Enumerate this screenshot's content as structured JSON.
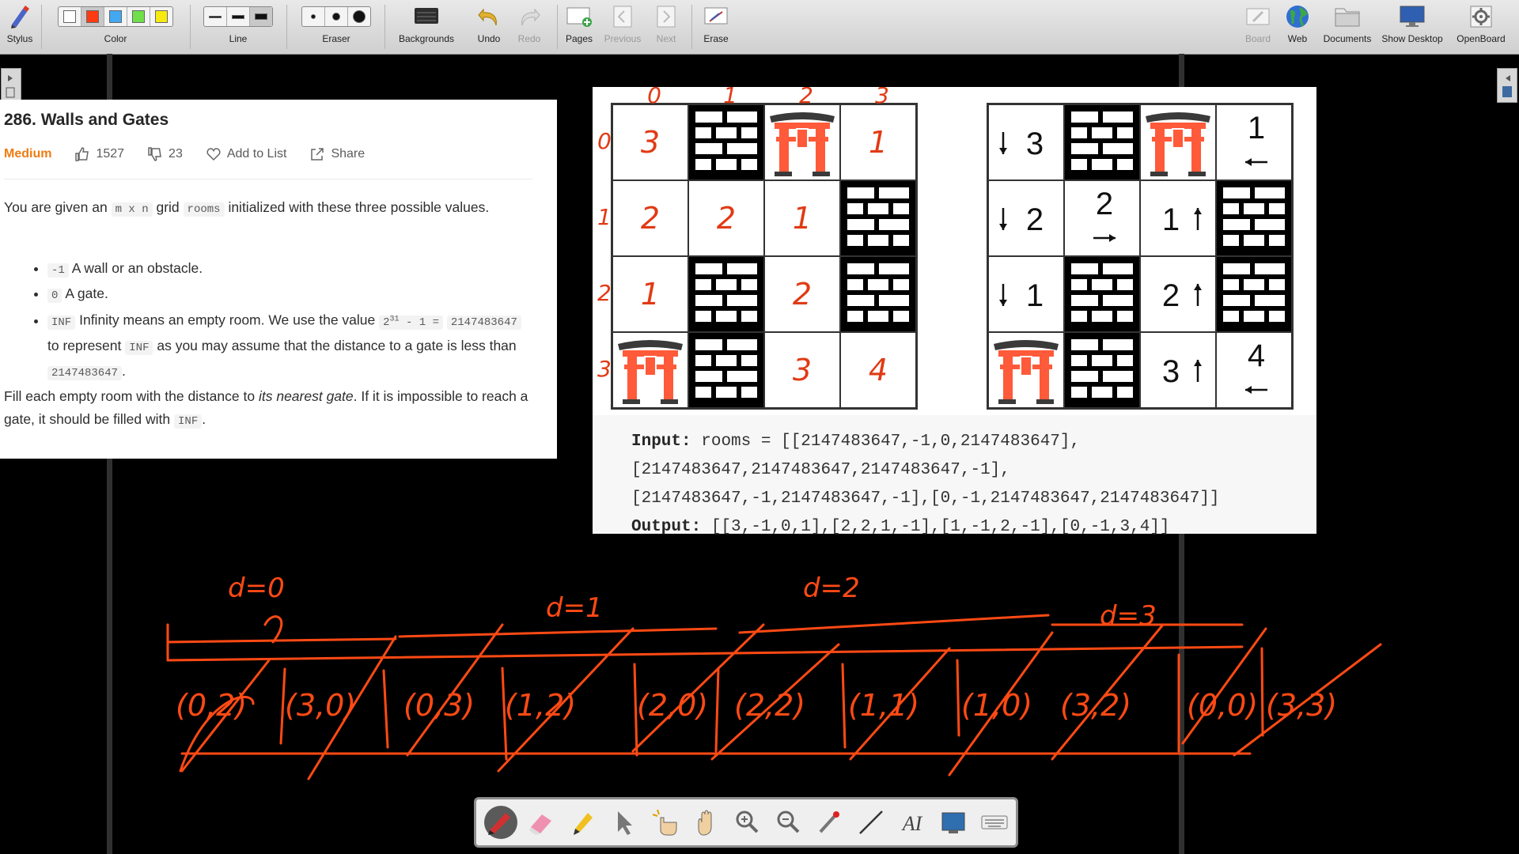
{
  "toolbar": {
    "stylus": "Stylus",
    "color": "Color",
    "line": "Line",
    "eraser": "Eraser",
    "backgrounds": "Backgrounds",
    "undo": "Undo",
    "redo": "Redo",
    "pages": "Pages",
    "previous": "Previous",
    "next": "Next",
    "erase": "Erase",
    "board": "Board",
    "web": "Web",
    "documents": "Documents",
    "show_desktop": "Show Desktop",
    "openboard": "OpenBoard",
    "colors": [
      "#ffffff",
      "#ff3a12",
      "#43a8f0",
      "#6fe04a",
      "#f7ea11"
    ],
    "selected_color": "#ff3a12"
  },
  "problem": {
    "title": "286. Walls and Gates",
    "difficulty": "Medium",
    "likes": "1527",
    "dislikes": "23",
    "add_to_list": "Add to List",
    "share": "Share",
    "p1_a": "You are given an",
    "p1_code1": "m x n",
    "p1_b": "grid",
    "p1_code2": "rooms",
    "p1_c": "initialized with these three possible values.",
    "b1_code": "-1",
    "b1_text": "A wall or an obstacle.",
    "b2_code": "0",
    "b2_text": "A gate.",
    "b3_code": "INF",
    "b3_a": "Infinity means an empty room. We use the value",
    "b3_pow_base": "2",
    "b3_pow_exp": "31",
    "b3_pow_rest": "- 1 =",
    "b3_code2": "2147483647",
    "b3_b": "to represent",
    "b3_code3": "INF",
    "b3_c": "as you may assume that the distance to a gate is less than",
    "b3_code4": "2147483647",
    "b3_d": ".",
    "p2_a": "Fill each empty room with the distance to",
    "p2_em": "its nearest gate",
    "p2_b": ". If it is impossible to reach a gate, it should be filled with",
    "p2_code": "INF",
    "p2_c": "."
  },
  "example": {
    "left_grid": [
      [
        "empty",
        "wall",
        "gate",
        "empty"
      ],
      [
        "empty",
        "empty",
        "empty",
        "wall"
      ],
      [
        "empty",
        "wall",
        "empty",
        "wall"
      ],
      [
        "gate",
        "wall",
        "empty",
        "empty"
      ]
    ],
    "left_handwritten": [
      [
        "3",
        "",
        "",
        "1"
      ],
      [
        "2",
        "2",
        "1",
        ""
      ],
      [
        "1",
        "",
        "2",
        ""
      ],
      [
        "",
        "",
        "3",
        "4"
      ]
    ],
    "col_marks": [
      "0",
      "1",
      "2",
      "3"
    ],
    "row_marks": [
      "0",
      "1",
      "2",
      "3"
    ],
    "right_grid": [
      [
        {
          "n": "3",
          "a": "down"
        },
        {
          "w": 1
        },
        {
          "g": 1
        },
        {
          "n": "1",
          "a": "left"
        }
      ],
      [
        {
          "n": "2",
          "a": "down"
        },
        {
          "n": "2",
          "a": "right"
        },
        {
          "n": "1",
          "a": "up"
        },
        {
          "w": 1
        }
      ],
      [
        {
          "n": "1",
          "a": "down"
        },
        {
          "w": 1
        },
        {
          "n": "2",
          "a": "up"
        },
        {
          "w": 1
        }
      ],
      [
        {
          "g": 1
        },
        {
          "w": 1
        },
        {
          "n": "3",
          "a": "up"
        },
        {
          "n": "4",
          "a": "left"
        }
      ]
    ],
    "input_label": "Input:",
    "input_line1": "rooms = [[2147483647,-1,0,2147483647],",
    "input_line2": "[2147483647,2147483647,2147483647,-1],",
    "input_line3": "[2147483647,-1,2147483647,-1],[0,-1,2147483647,2147483647]]",
    "output_label": "Output:",
    "output_value": "[[3,-1,0,1],[2,2,1,-1],[1,-1,2,-1],[0,-1,3,4]]"
  },
  "annotations": {
    "levels": [
      "d=0",
      "d=1",
      "d=2",
      "d=3"
    ],
    "queue": [
      "(0,2)",
      "(3,0)",
      "(0,3)",
      "(1,2)",
      "(2,0)",
      "(2,2)",
      "(1,1)",
      "(1,0)",
      "(3,2)",
      "(0,0)",
      "(3,3)"
    ],
    "ink_color": "#ff4a14"
  },
  "palette": {
    "tools": [
      "pen-tool",
      "eraser-tool",
      "highlighter-tool",
      "selector-tool",
      "interact-tool",
      "hand-tool",
      "zoom-in-tool",
      "zoom-out-tool",
      "laser-pointer-tool",
      "line-tool",
      "text-tool",
      "capture-tool",
      "keyboard-tool"
    ]
  }
}
